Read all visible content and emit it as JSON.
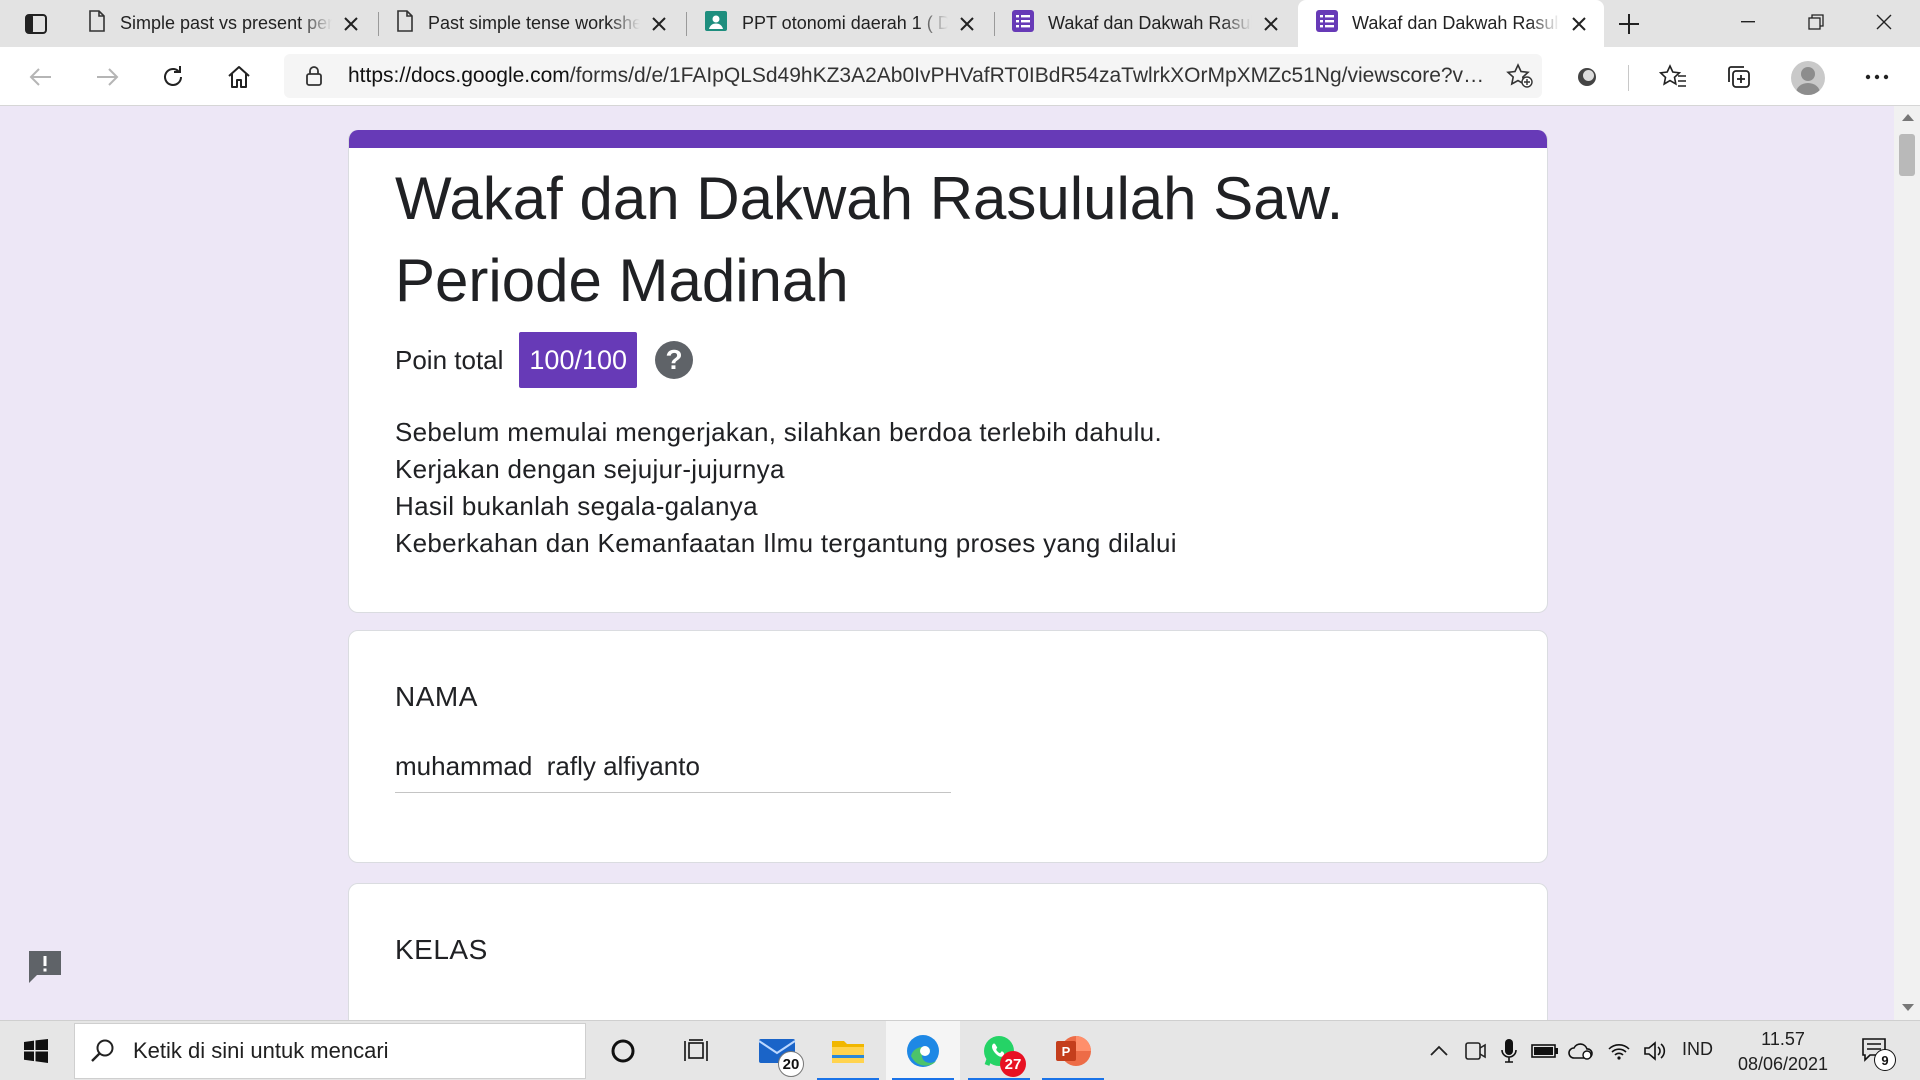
{
  "browser": {
    "tabs": [
      {
        "title": "Simple past vs present per",
        "icon": "document-icon",
        "active": false
      },
      {
        "title": "Past simple tense workshe",
        "icon": "document-icon",
        "active": false
      },
      {
        "title": "PPT otonomi daerah 1 ( D",
        "icon": "classroom-icon",
        "active": false
      },
      {
        "title": "Wakaf dan Dakwah Rasulu",
        "icon": "forms-icon",
        "active": false
      },
      {
        "title": "Wakaf dan Dakwah Rasulu",
        "icon": "forms-icon",
        "active": true
      }
    ],
    "url_host": "https://docs.google.com",
    "url_path": "/forms/d/e/1FAIpQLSd49hKZ3A2Ab0IvPHVafRT0IBdR54zaTwlrkXOrMpXMZc51Ng/viewscore?vie..."
  },
  "form": {
    "accent_color": "#673ab7",
    "title": "Wakaf dan Dakwah Rasululah Saw. Periode Madinah",
    "score_label": "Poin total",
    "score_value": "100/100",
    "help_glyph": "?",
    "description": [
      "Sebelum memulai mengerjakan, silahkan berdoa terlebih dahulu.",
      "Kerjakan dengan sejujur-jujurnya",
      "Hasil bukanlah segala-galanya",
      "Keberkahan dan Kemanfaatan Ilmu tergantung proses yang dilalui"
    ],
    "questions": [
      {
        "title": "NAMA",
        "answer": "muhammad  rafly alfiyanto"
      },
      {
        "title": "KELAS",
        "answer": ""
      }
    ]
  },
  "taskbar": {
    "search_placeholder": "Ketik di sini untuk mencari",
    "mail_badge": "20",
    "whatsapp_badge": "27",
    "language": "IND",
    "time": "11.57",
    "date": "08/06/2021",
    "notification_count": "9"
  }
}
